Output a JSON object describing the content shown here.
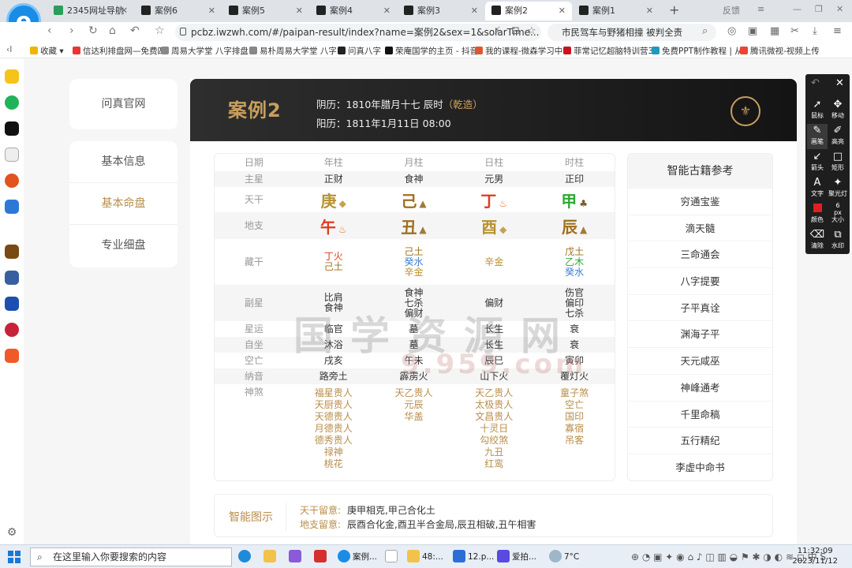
{
  "browser": {
    "tabs": [
      {
        "title": "2345网址导航",
        "active": false
      },
      {
        "title": "案例6",
        "active": false
      },
      {
        "title": "案例5",
        "active": false
      },
      {
        "title": "案例4",
        "active": false
      },
      {
        "title": "案例3",
        "active": false
      },
      {
        "title": "案例2",
        "active": true
      },
      {
        "title": "案例1",
        "active": false
      }
    ],
    "new_tab": "+",
    "feedback": "反馈",
    "url": "pcbz.iwzwh.com/#/paipan-result/index?name=案例2&sex=1&solarTime...",
    "search_text": "市民驾车与野猪相撞 被判全责",
    "bookmarks": [
      "收藏",
      "信达利排盘网—免费四",
      "周易大学堂 八字排盘",
      "易朴周易大学堂 八字",
      "问真八字",
      "荣庵国学的主页 - 抖音",
      "我的课程-微森学习中",
      "菲常记忆超脑特训营3",
      "免费PPT制作教程 | 从",
      "腾讯微视-视频上传"
    ]
  },
  "sidebar": {
    "top": "问真官网",
    "items": [
      "基本信息",
      "基本命盘",
      "专业细盘"
    ],
    "active": "基本命盘"
  },
  "header": {
    "title": "案例2",
    "lunar": "阴历：1810年腊月十七 辰时",
    "lunar_tag": "（乾造）",
    "solar": "阳历：1811年1月11日 08:00",
    "seal_glyph": "⚜"
  },
  "bazi": {
    "columns": [
      "日期",
      "年柱",
      "月柱",
      "日柱",
      "时柱"
    ],
    "main_star": {
      "label": "主星",
      "values": [
        "正财",
        "食神",
        "元男",
        "正印"
      ]
    },
    "stems": {
      "label": "天干",
      "values": [
        "庚",
        "己",
        "丁",
        "甲"
      ],
      "elements": [
        "metal",
        "earth",
        "fire",
        "wood"
      ]
    },
    "branches": {
      "label": "地支",
      "values": [
        "午",
        "丑",
        "酉",
        "辰"
      ],
      "elements": [
        "fire",
        "earth",
        "metal",
        "earth"
      ]
    },
    "hidden": {
      "label": "藏干",
      "values": [
        [
          {
            "t": "丁火",
            "e": "fire"
          },
          {
            "t": "己土",
            "e": "earth"
          }
        ],
        [
          {
            "t": "己土",
            "e": "earth"
          },
          {
            "t": "癸水",
            "e": "water"
          },
          {
            "t": "辛金",
            "e": "metal"
          }
        ],
        [
          {
            "t": "辛金",
            "e": "metal"
          }
        ],
        [
          {
            "t": "戊土",
            "e": "earth"
          },
          {
            "t": "乙木",
            "e": "wood"
          },
          {
            "t": "癸水",
            "e": "water"
          }
        ]
      ]
    },
    "sub_star": {
      "label": "副星",
      "values": [
        [
          "比肩",
          "食神"
        ],
        [
          "食神",
          "七杀",
          "偏财"
        ],
        [
          "偏财"
        ],
        [
          "伤官",
          "偏印",
          "七杀"
        ]
      ]
    },
    "xingyun": {
      "label": "星运",
      "values": [
        "临官",
        "墓",
        "长生",
        "衰"
      ]
    },
    "zizuo": {
      "label": "自坐",
      "values": [
        "沐浴",
        "墓",
        "长生",
        "衰"
      ]
    },
    "kongwang": {
      "label": "空亡",
      "values": [
        "戌亥",
        "午未",
        "辰巳",
        "寅卯"
      ]
    },
    "nayin": {
      "label": "纳音",
      "values": [
        "路旁土",
        "霹雳火",
        "山下火",
        "覆灯火"
      ]
    },
    "shensha": {
      "label": "神煞",
      "values": [
        [
          "福星贵人",
          "天厨贵人",
          "天德贵人",
          "月德贵人",
          "德秀贵人",
          "禄神",
          "桃花"
        ],
        [
          "天乙贵人",
          "元辰",
          "华盖"
        ],
        [
          "天乙贵人",
          "太极贵人",
          "文昌贵人",
          "十灵日",
          "勾绞煞",
          "九丑",
          "红鸾"
        ],
        [
          "童子煞",
          "空亡",
          "国印",
          "寡宿",
          "吊客"
        ]
      ]
    }
  },
  "books": {
    "title": "智能古籍参考",
    "items": [
      "穷通宝鉴",
      "滴天髓",
      "三命通会",
      "八字提要",
      "子平真诠",
      "渊海子平",
      "天元咸巫",
      "神峰通考",
      "千里命稿",
      "五行精纪",
      "李虚中命书"
    ]
  },
  "diagram": {
    "label": "智能图示",
    "stem_key": "天干留意:",
    "stem_value": "庚甲相克,甲己合化土",
    "branch_key": "地支留意:",
    "branch_value": "辰酉合化金,酉丑半合金局,辰丑相破,丑午相害"
  },
  "watermark": {
    "line1": "国学资源网",
    "line2": "9.959.com"
  },
  "annotation_tool": {
    "tools": [
      {
        "label": "鼠标",
        "icon": "cursor-icon"
      },
      {
        "label": "移动",
        "icon": "move-icon"
      },
      {
        "label": "画笔",
        "icon": "pen-icon"
      },
      {
        "label": "高亮",
        "icon": "highlighter-icon"
      },
      {
        "label": "箭头",
        "icon": "arrow-icon"
      },
      {
        "label": "矩形",
        "icon": "rectangle-icon"
      },
      {
        "label": "文字",
        "icon": "text-icon"
      },
      {
        "label": "聚光灯",
        "icon": "spotlight-icon"
      },
      {
        "label": "颜色",
        "icon": "color-icon"
      },
      {
        "label": "大小",
        "icon": "size-icon"
      },
      {
        "label": "清除",
        "icon": "eraser-icon"
      },
      {
        "label": "水印",
        "icon": "watermark-icon"
      }
    ],
    "size_value": "6",
    "size_unit": "px"
  },
  "taskbar": {
    "search_placeholder": "在这里输入你要搜索的内容",
    "apps": [
      "案例...",
      "48:...",
      "12.p...",
      "爱拍..."
    ],
    "weather": "7°C",
    "time": "11:32:09",
    "date": "2023/11/12"
  },
  "colors": {
    "fire": "#e03a1e",
    "earth": "#a06e1d",
    "metal": "#b89230",
    "wood": "#2ea836",
    "water": "#3d7fd6",
    "accent": "#b88d4a"
  }
}
